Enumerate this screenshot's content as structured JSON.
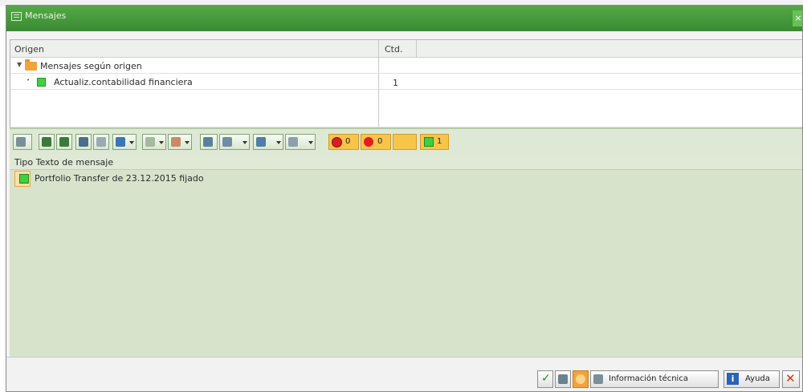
{
  "window": {
    "title": "Mensajes"
  },
  "tree": {
    "columns": {
      "origen": "Origen",
      "ctd": "Ctd."
    },
    "rows": [
      {
        "label": "Mensajes según origen",
        "count": ""
      },
      {
        "label": "Actualiz.contabilidad financiera",
        "count": "1"
      }
    ]
  },
  "toolbar": {
    "stop_count": "0",
    "error_count": "0",
    "success_count": "1"
  },
  "messages": {
    "header": "Tipo Texto de mensaje",
    "items": [
      {
        "type": "success",
        "text": "Portfolio Transfer de 23.12.2015 fijado"
      }
    ]
  },
  "footer": {
    "info_label": "Información técnica",
    "help_label": "Ayuda"
  },
  "colors": {
    "title_green": "#3a8a33",
    "status_green": "#3fcf3f",
    "status_red": "#d62020",
    "status_yellow": "#f7c54a",
    "panel_green": "#d8e3cc"
  }
}
